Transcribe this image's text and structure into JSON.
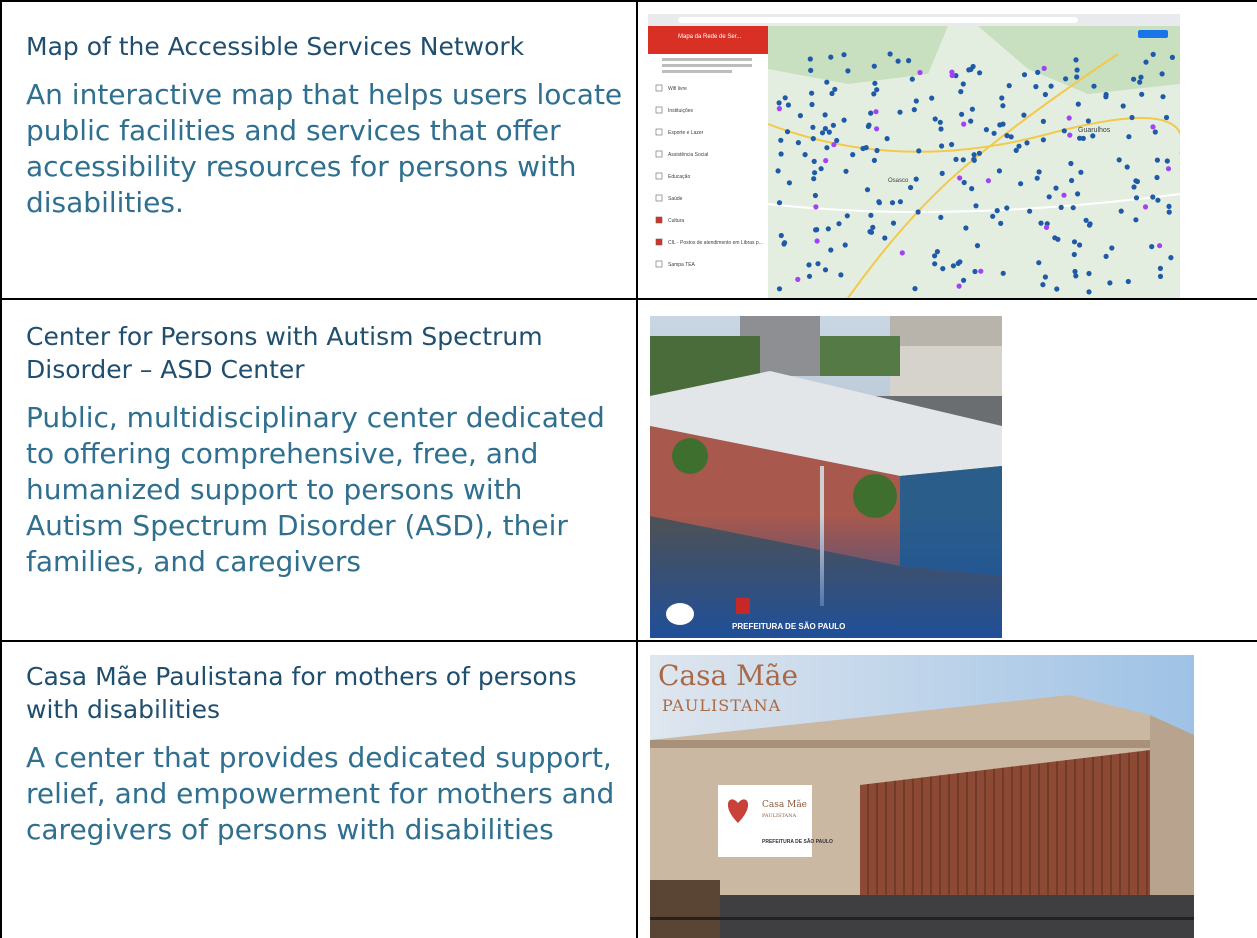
{
  "rows": [
    {
      "title": "Map of the Accessible Services Network",
      "description": "An interactive map that helps users locate public facilities and services that offer accessibility resources for persons with disabilities."
    },
    {
      "title": "Center for Persons with Autism Spectrum Disorder – ASD Center",
      "description": "Public, multidisciplinary center dedicated to offering comprehensive, free, and humanized support to persons with Autism Spectrum Disorder (ASD), their families, and caregivers"
    },
    {
      "title": "Casa Mãe Paulistana for mothers of persons with disabilities",
      "description": "A center that provides dedicated support, relief, and empowerment for mothers and caregivers of persons with disabilities"
    }
  ],
  "map_image": {
    "panel_title": "Mapa da Rede de Ser...",
    "filters": [
      "Wifi livre",
      "Instituições",
      "Esporte e Lazer",
      "Assistência Social",
      "Educação",
      "Saúde",
      "Cultura",
      "CIL - Postos de atendimento em Libras p...",
      "Sampa TEA"
    ],
    "places": [
      "Guarulhos",
      "Osasco"
    ]
  },
  "asd_image": {
    "logo_text": "PREFEITURA DE SÃO PAULO"
  },
  "casa_image": {
    "sign_line1": "Casa Mãe",
    "sign_line2": "PAULISTANA",
    "banner_line1": "Casa Mãe",
    "banner_line2": "PAULISTANA",
    "banner_logo": "PREFEITURA DE SÃO PAULO"
  }
}
